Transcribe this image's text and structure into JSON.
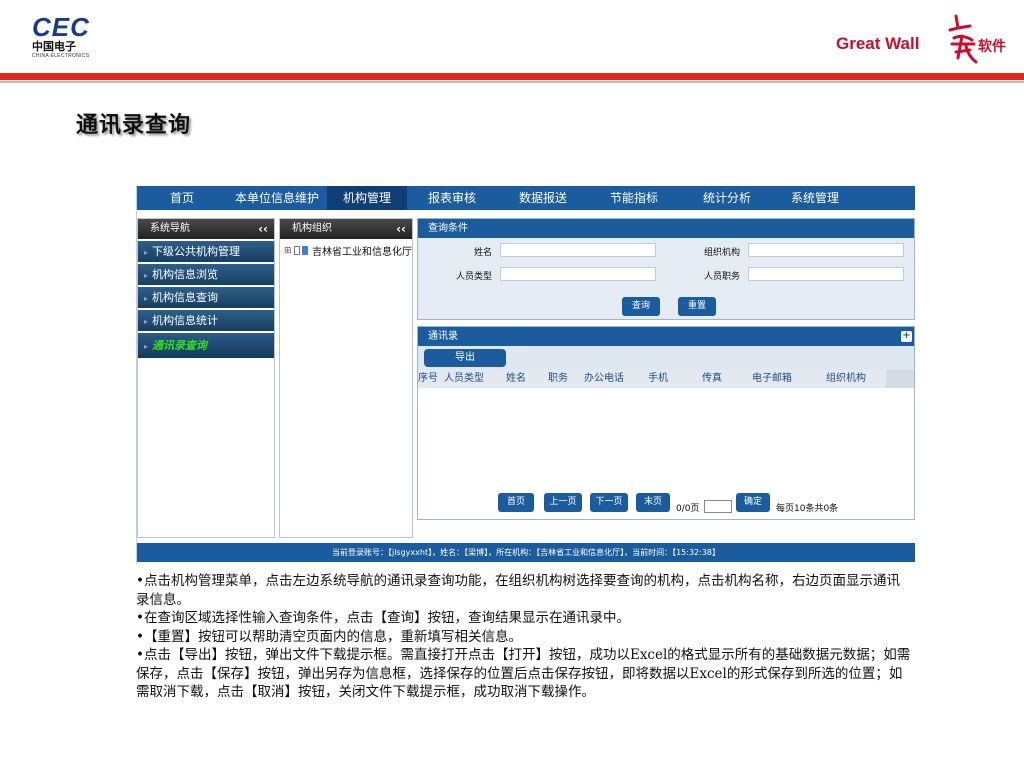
{
  "header": {
    "cec_logo": {
      "mark": "CEC",
      "cn": "中国电子",
      "en": "CHINA ELECTRONICS"
    },
    "gw_logo": {
      "text": "Great Wall",
      "soft": "软件"
    },
    "title": "通讯录查询"
  },
  "app": {
    "nav": [
      "首页",
      "本单位信息维护",
      "机构管理",
      "报表审核",
      "数据报送",
      "节能指标",
      "统计分析",
      "系统管理"
    ],
    "nav_active_index": 2,
    "sidebar": {
      "title": "系统导航",
      "collapse": "‹‹",
      "items": [
        "下级公共机构管理",
        "机构信息浏览",
        "机构信息查询",
        "机构信息统计",
        "通讯录查询"
      ],
      "active_index": 4
    },
    "org_tree": {
      "title": "机构组织",
      "collapse": "‹‹",
      "plus": "⊞",
      "node": "吉林省工业和信息化厅"
    },
    "query": {
      "title": "查询条件",
      "name_label": "姓名",
      "org_label": "组织机构",
      "type_label": "人员类型",
      "position_label": "人员职务",
      "search_btn": "查询",
      "reset_btn": "重置"
    },
    "contacts": {
      "title": "通讯录",
      "expand": "+",
      "export_btn": "导出",
      "columns": [
        "序号",
        "人员类型",
        "姓名",
        "职务",
        "办公电话",
        "手机",
        "传真",
        "电子邮箱",
        "组织机构"
      ]
    },
    "pager": {
      "first": "首页",
      "prev": "上一页",
      "next": "下一页",
      "last": "末页",
      "page_info": "0/0页",
      "confirm": "确定",
      "summary": "每页10条共0条"
    },
    "status": "当前登录账号：【jlsgyxxht】，姓名：【梁博】，所在机构：【吉林省工业和信息化厅】，当前时间：【15:32:38】"
  },
  "description": [
    "•点击机构管理菜单，点击左边系统导航的通讯录查询功能，在组织机构树选择要查询的机构，点击机构名称，右边页面显示通讯录信息。",
    "•在查询区域选择性输入查询条件，点击【查询】按钮，查询结果显示在通讯录中。",
    "•【重置】按钮可以帮助清空页面内的信息，重新填写相关信息。",
    "•点击【导出】按钮，弹出文件下载提示框。需直接打开点击【打开】按钮，成功以Excel的格式显示所有的基础数据元数据；如需保存，点击【保存】按钮，弹出另存为信息框，选择保存的位置后点击保存按钮，即将数据以Excel的形式保存到所选的位置；如需取消下载，点击【取消】按钮，关闭文件下载提示框，成功取消下载操作。"
  ]
}
